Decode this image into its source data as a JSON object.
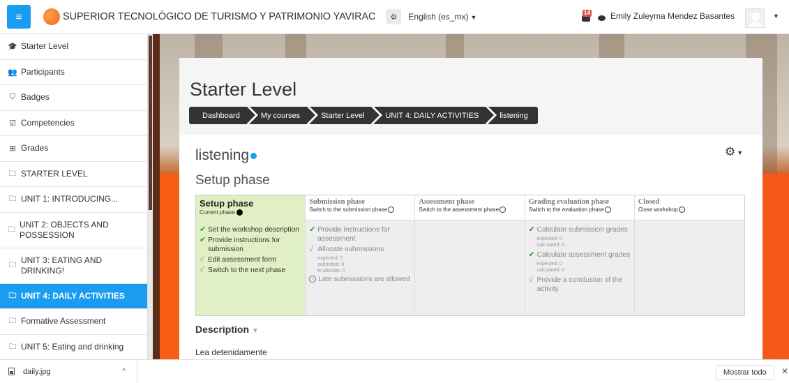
{
  "header": {
    "menu_icon": "hamburger-icon",
    "site_name": "SUPERIOR TECNOLÓGICO DE TURISMO Y PATRIMONIO YAVIRAC",
    "language": "English (es_mx)",
    "notification_count": "14",
    "user_name": "Emily Zuleyma Mendez Basantes"
  },
  "sidebar": {
    "items": [
      {
        "label": "Starter Level",
        "icon": "graduation-cap-icon"
      },
      {
        "label": "Participants",
        "icon": "users-icon"
      },
      {
        "label": "Badges",
        "icon": "shield-icon"
      },
      {
        "label": "Competencies",
        "icon": "checkbox-icon"
      },
      {
        "label": "Grades",
        "icon": "table-icon"
      },
      {
        "label": "STARTER LEVEL",
        "icon": "folder-icon"
      },
      {
        "label": "UNIT 1: INTRODUCING...",
        "icon": "folder-icon"
      },
      {
        "label": "UNIT 2: OBJECTS AND POSSESSION",
        "icon": "folder-icon"
      },
      {
        "label": "UNIT 3: EATING AND DRINKING!",
        "icon": "folder-icon"
      },
      {
        "label": "UNIT 4: DAILY ACTIVITIES",
        "icon": "folder-icon",
        "active": true
      },
      {
        "label": "Formative Assessment",
        "icon": "folder-icon"
      },
      {
        "label": "UNIT 5: Eating and drinking",
        "icon": "folder-icon"
      }
    ]
  },
  "page": {
    "title": "Starter Level",
    "breadcrumb": [
      "Dashboard",
      "My courses",
      "Starter Level",
      "UNIT 4: DAILY ACTIVITIES",
      "listening"
    ],
    "activity_title": "listening",
    "phase_heading": "Setup phase"
  },
  "phases": [
    {
      "name": "Setup phase",
      "switch": "Current phase",
      "current": true,
      "tasks": [
        {
          "text": "Set the workshop description",
          "done": true
        },
        {
          "text": "Provide instructions for submission",
          "done": true
        },
        {
          "text": "Edit assessment form",
          "done": false
        },
        {
          "text": "Switch to the next phase",
          "done": false
        }
      ]
    },
    {
      "name": "Submission phase",
      "switch": "Switch to the submission phase",
      "tasks": [
        {
          "text": "Provide instructions for assessment",
          "done": true
        },
        {
          "text": "Allocate submissions",
          "done": false,
          "info": [
            "expected: 0",
            "submitted: 0",
            "to allocate: 0"
          ]
        }
      ],
      "note": "Late submissions are allowed"
    },
    {
      "name": "Assessment phase",
      "switch": "Switch to the assessment phase",
      "tasks": []
    },
    {
      "name": "Grading evaluation phase",
      "switch": "Switch to the evaluation phase",
      "tasks": [
        {
          "text": "Calculate submission grades",
          "done": true,
          "info": [
            "expected: 0",
            "calculated: 0"
          ]
        },
        {
          "text": "Calculate assessment grades",
          "done": true,
          "info": [
            "expected: 0",
            "calculated: 0"
          ]
        },
        {
          "text": "Provide a conclusion of the activity",
          "done": false
        }
      ]
    },
    {
      "name": "Closed",
      "switch": "Close workshop",
      "tasks": []
    }
  ],
  "description": {
    "title": "Description",
    "text": "Lea detenidamente"
  },
  "downloads": {
    "file": "daily.jpg",
    "show_all": "Mostrar todo"
  },
  "colors": {
    "accent": "#1a9cf0",
    "breadcrumb_bg": "#333333",
    "current_phase_bg": "#e1efc4",
    "hero_orange": "#f65c14"
  }
}
